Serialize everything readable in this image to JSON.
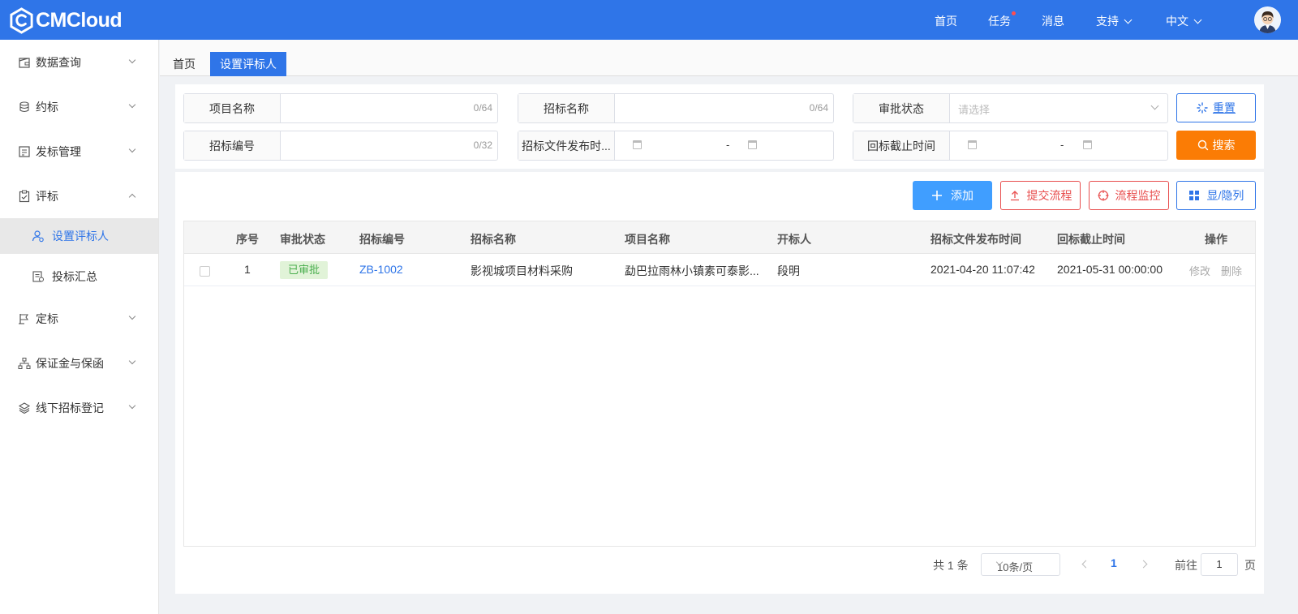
{
  "header": {
    "brand": "CMCloud",
    "nav": {
      "home": "首页",
      "tasks": "任务",
      "messages": "消息",
      "support": "支持",
      "language": "中文"
    },
    "colors": {
      "bar": "#2f75e8",
      "task_dot": "#ff4d4f"
    }
  },
  "sidebar": {
    "items": [
      {
        "label": "数据查询",
        "icon": "wallet-icon",
        "expanded": false
      },
      {
        "label": "约标",
        "icon": "coins-icon",
        "expanded": false
      },
      {
        "label": "发标管理",
        "icon": "document-icon",
        "expanded": false
      },
      {
        "label": "评标",
        "icon": "clipboard-check-icon",
        "expanded": true
      },
      {
        "label": "定标",
        "icon": "flag-icon",
        "expanded": false
      },
      {
        "label": "保证金与保函",
        "icon": "org-chart-icon",
        "expanded": false
      },
      {
        "label": "线下招标登记",
        "icon": "layers-icon",
        "expanded": false
      }
    ],
    "sub_items": [
      {
        "label": "设置评标人",
        "icon": "user-settings-icon",
        "active": true
      },
      {
        "label": "投标汇总",
        "icon": "summary-doc-icon",
        "active": false
      }
    ]
  },
  "tabs": [
    {
      "label": "首页",
      "active": false
    },
    {
      "label": "设置评标人",
      "active": true
    }
  ],
  "filters": {
    "project_name": {
      "label": "项目名称",
      "counter": "0/64"
    },
    "tender_name": {
      "label": "招标名称",
      "counter": "0/64"
    },
    "approval_status": {
      "label": "审批状态",
      "placeholder": "请选择"
    },
    "tender_no": {
      "label": "招标编号",
      "counter": "0/32"
    },
    "publish_time": {
      "label": "招标文件发布时...",
      "separator": "-"
    },
    "deadline": {
      "label": "回标截止时间",
      "separator": "-"
    },
    "reset_label": "重置",
    "search_label": "搜索"
  },
  "toolbar": {
    "add": "添加",
    "submit_flow": "提交流程",
    "monitor_flow": "流程监控",
    "toggle_columns": "显/隐列"
  },
  "table": {
    "columns": [
      "序号",
      "审批状态",
      "招标编号",
      "招标名称",
      "项目名称",
      "开标人",
      "招标文件发布时间",
      "回标截止时间",
      "操作"
    ],
    "rows": [
      {
        "index": "1",
        "status": "已审批",
        "tender_no": "ZB-1002",
        "tender_name": "影视城项目材料采购",
        "project_name": "勐巴拉雨林小镇素可泰影...",
        "opener": "段明",
        "publish_time": "2021-04-20 11:07:42",
        "deadline": "2021-05-31 00:00:00",
        "edit": "修改",
        "delete": "删除"
      }
    ]
  },
  "pagination": {
    "total": "共 1 条",
    "page_size": "10条/页",
    "current": "1",
    "goto_label": "前往",
    "goto_value": "1",
    "page_suffix": "页"
  }
}
